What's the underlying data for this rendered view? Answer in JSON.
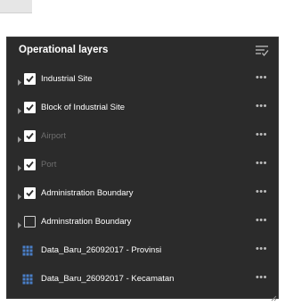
{
  "panel": {
    "title": "Operational layers",
    "more_label": "•••",
    "layers": [
      {
        "label": "Industrial Site",
        "checked": true,
        "dimmed": false,
        "kind": "layer"
      },
      {
        "label": "Block of Industrial Site",
        "checked": true,
        "dimmed": false,
        "kind": "layer"
      },
      {
        "label": "Airport",
        "checked": true,
        "dimmed": true,
        "kind": "layer"
      },
      {
        "label": "Port",
        "checked": true,
        "dimmed": true,
        "kind": "layer"
      },
      {
        "label": "Administration Boundary",
        "checked": true,
        "dimmed": false,
        "kind": "layer"
      },
      {
        "label": "Adminstration Boundary",
        "checked": false,
        "dimmed": false,
        "kind": "layer"
      },
      {
        "label": "Data_Baru_26092017 - Provinsi",
        "checked": null,
        "dimmed": false,
        "kind": "table"
      },
      {
        "label": "Data_Baru_26092017 - Kecamatan",
        "checked": null,
        "dimmed": false,
        "kind": "table"
      }
    ]
  },
  "colors": {
    "panel_background": "#2b2b2b",
    "table_icon": "#4a7fc8",
    "dimmed_text": "#6e6e6e"
  }
}
